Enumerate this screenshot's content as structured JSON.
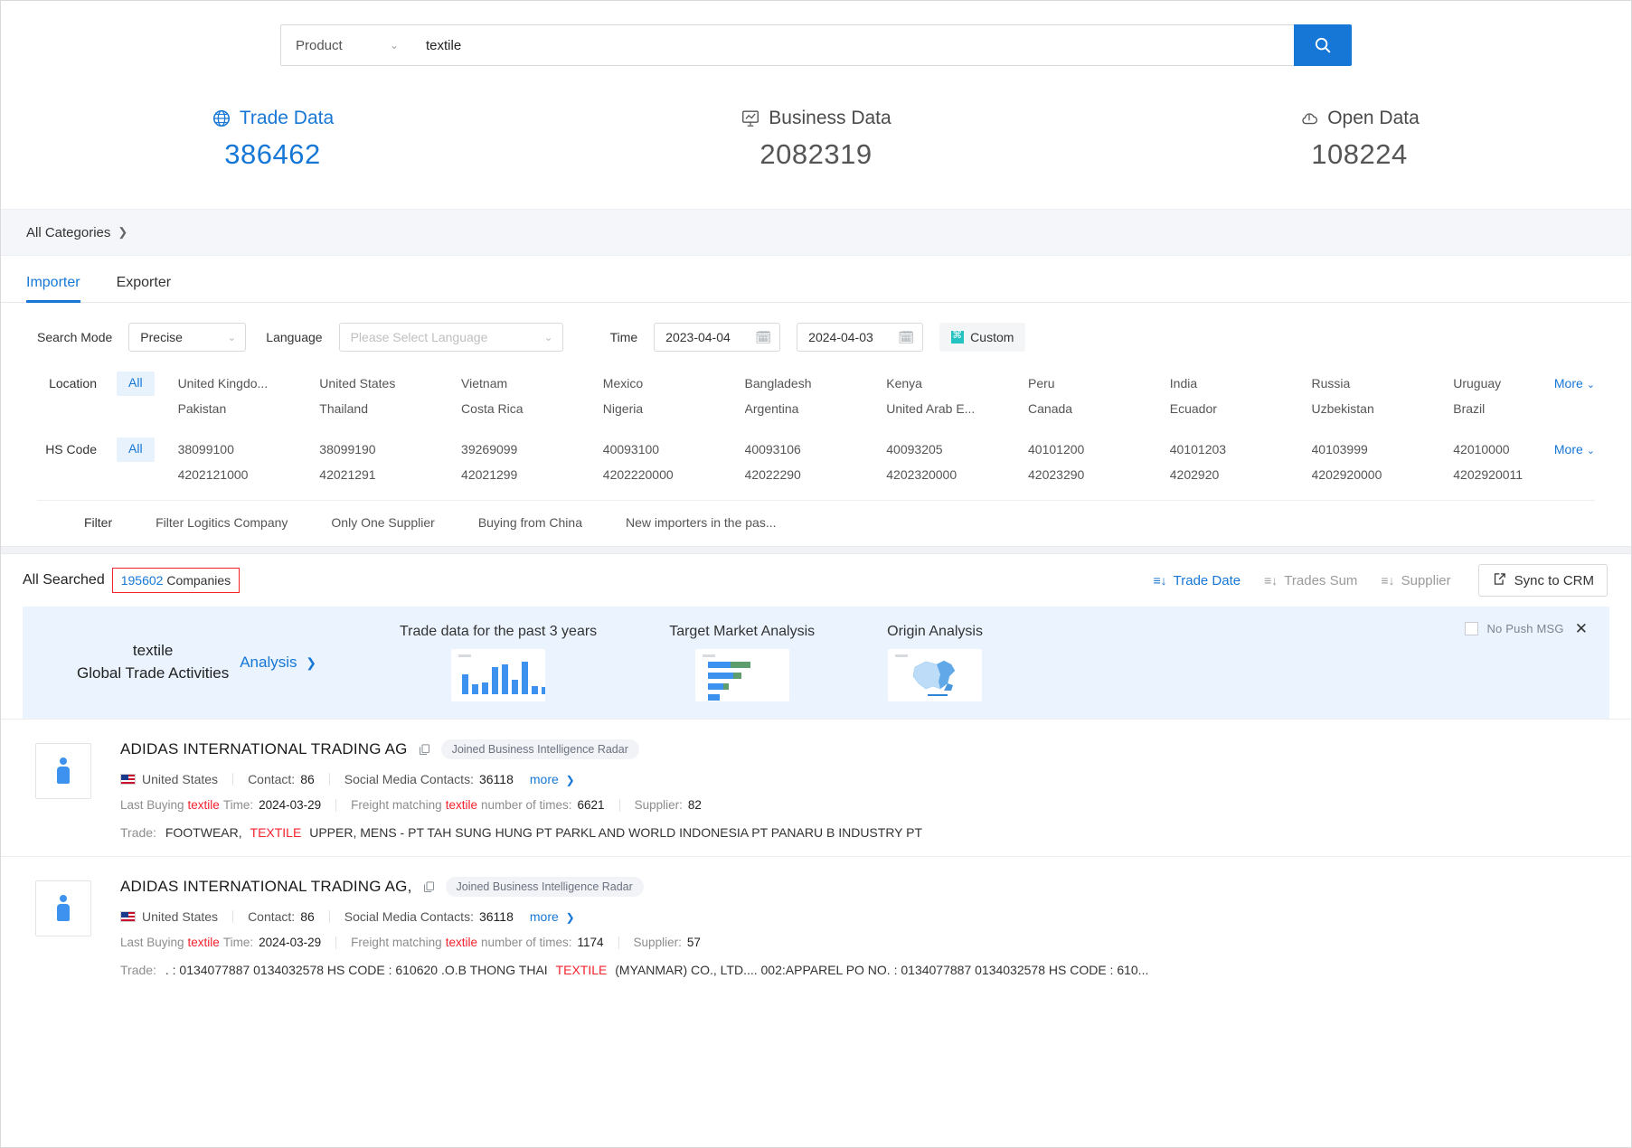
{
  "search": {
    "scope_label": "Product",
    "query": "textile",
    "search_icon": "search-icon"
  },
  "stats": [
    {
      "label": "Trade Data",
      "value": "386462",
      "icon": "globe-icon",
      "active": true
    },
    {
      "label": "Business Data",
      "value": "2082319",
      "icon": "presentation-chart-icon",
      "active": false
    },
    {
      "label": "Open Data",
      "value": "108224",
      "icon": "cloud-upload-icon",
      "active": false
    }
  ],
  "categories_bar": {
    "label": "All Categories"
  },
  "tabs": [
    {
      "label": "Importer",
      "active": true
    },
    {
      "label": "Exporter",
      "active": false
    }
  ],
  "filters": {
    "search_mode_label": "Search Mode",
    "search_mode_value": "Precise",
    "language_label": "Language",
    "language_placeholder": "Please Select Language",
    "time_label": "Time",
    "date_from": "2023-04-04",
    "date_to": "2024-04-03",
    "custom_label": "Custom",
    "location": {
      "name": "Location",
      "all_label": "All",
      "more_label": "More",
      "items": [
        "United Kingdo...",
        "United States",
        "Vietnam",
        "Mexico",
        "Bangladesh",
        "Kenya",
        "Peru",
        "India",
        "Russia",
        "Uruguay",
        "Pakistan",
        "Thailand",
        "Costa Rica",
        "Nigeria",
        "Argentina",
        "United Arab E...",
        "Canada",
        "Ecuador",
        "Uzbekistan",
        "Brazil"
      ]
    },
    "hs_code": {
      "name": "HS Code",
      "all_label": "All",
      "more_label": "More",
      "items": [
        "38099100",
        "38099190",
        "39269099",
        "40093100",
        "40093106",
        "40093205",
        "40101200",
        "40101203",
        "40103999",
        "42010000",
        "4202121000",
        "42021291",
        "42021299",
        "4202220000",
        "42022290",
        "4202320000",
        "42023290",
        "4202920",
        "4202920000",
        "4202920011"
      ]
    },
    "filter_row": {
      "label": "Filter",
      "chips": [
        "Filter Logitics Company",
        "Only One Supplier",
        "Buying from China",
        "New importers in the pas..."
      ]
    }
  },
  "results_bar": {
    "prefix": "All Searched",
    "count": "195602",
    "suffix": "Companies",
    "sorts": [
      {
        "label": "Trade Date",
        "active": true
      },
      {
        "label": "Trades Sum",
        "active": false
      },
      {
        "label": "Supplier",
        "active": false
      }
    ],
    "crm_button": "Sync to CRM"
  },
  "banner": {
    "keyword": "textile",
    "subtitle": "Global Trade Activities",
    "analysis_link": "Analysis",
    "cards": [
      {
        "title": "Trade data for the past 3 years",
        "thumb": "bar-chart-thumb"
      },
      {
        "title": "Target Market Analysis",
        "thumb": "horizontal-bar-chart-thumb"
      },
      {
        "title": "Origin Analysis",
        "thumb": "china-map-thumb"
      }
    ],
    "no_push_label": "No Push MSG",
    "close_label": "✕"
  },
  "results": [
    {
      "company": "ADIDAS INTERNATIONAL TRADING AG",
      "badge": "Joined Business Intelligence Radar",
      "country": "United States",
      "contact_label": "Contact:",
      "contact_value": "86",
      "social_label": "Social Media Contacts:",
      "social_value": "36118",
      "more_label": "more",
      "last_buying_prefix": "Last Buying",
      "last_buying_keyword": "textile",
      "last_buying_mid": "Time:",
      "last_buying_value": "2024-03-29",
      "freight_prefix": "Freight matching",
      "freight_keyword": "textile",
      "freight_mid": "number of times:",
      "freight_value": "6621",
      "supplier_label": "Supplier:",
      "supplier_value": "82",
      "trade_label": "Trade:",
      "trade_pre": "FOOTWEAR,",
      "trade_keyword": "TEXTILE",
      "trade_post": "UPPER, MENS - PT TAH SUNG HUNG PT PARKL AND WORLD INDONESIA PT PANARU B INDUSTRY PT"
    },
    {
      "company": "ADIDAS INTERNATIONAL TRADING AG,",
      "badge": "Joined Business Intelligence Radar",
      "country": "United States",
      "contact_label": "Contact:",
      "contact_value": "86",
      "social_label": "Social Media Contacts:",
      "social_value": "36118",
      "more_label": "more",
      "last_buying_prefix": "Last Buying",
      "last_buying_keyword": "textile",
      "last_buying_mid": "Time:",
      "last_buying_value": "2024-03-29",
      "freight_prefix": "Freight matching",
      "freight_keyword": "textile",
      "freight_mid": "number of times:",
      "freight_value": "1174",
      "supplier_label": "Supplier:",
      "supplier_value": "57",
      "trade_label": "Trade:",
      "trade_pre": ". : 0134077887 0134032578 HS CODE : 610620 .O.B THONG THAI",
      "trade_keyword": "TEXTILE",
      "trade_post": "(MYANMAR) CO., LTD.... 002:APPAREL PO NO. : 0134077887 0134032578 HS CODE : 610..."
    }
  ],
  "colors": {
    "accent": "#1677d6",
    "highlight_red": "#f5222d",
    "banner_bg": "#eaf3fe"
  }
}
